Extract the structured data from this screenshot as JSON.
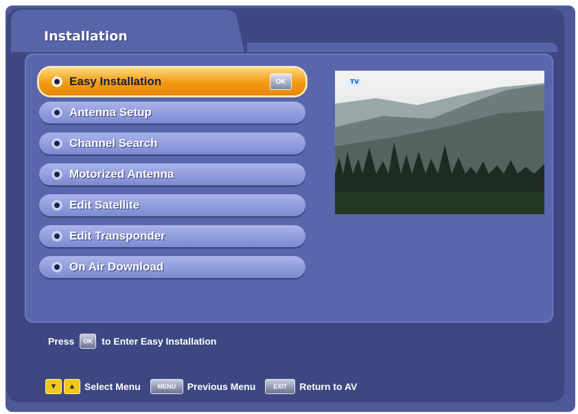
{
  "screen": {
    "title": "Installation",
    "menu_items": [
      {
        "label": "Easy Installation",
        "selected": true,
        "badge": "OK"
      },
      {
        "label": "Antenna Setup",
        "selected": false
      },
      {
        "label": "Channel Search",
        "selected": false
      },
      {
        "label": "Motorized Antenna",
        "selected": false
      },
      {
        "label": "Edit Satellite",
        "selected": false
      },
      {
        "label": "Edit Transponder",
        "selected": false
      },
      {
        "label": "On Air Download",
        "selected": false
      }
    ],
    "preview": {
      "channel_badge": "TV",
      "description": "live video preview"
    }
  },
  "help": {
    "press_prefix": "Press",
    "press_key": "OK",
    "press_suffix": "to Enter Easy Installation"
  },
  "legend": {
    "select_label": "Select Menu",
    "menu_key": "MENU",
    "menu_label": "Previous Menu",
    "exit_key": "EXIT",
    "exit_label": "Return to AV"
  },
  "colors": {
    "background": "#3e4781",
    "panel": "#5966ac",
    "selected_item": "#f29a12",
    "menu_item": "#8d99dc",
    "text": "#ffffff"
  },
  "icons": {
    "menu_bullet": "radio-dot-icon",
    "navigation": [
      "arrow-down-icon",
      "arrow-up-icon"
    ]
  }
}
